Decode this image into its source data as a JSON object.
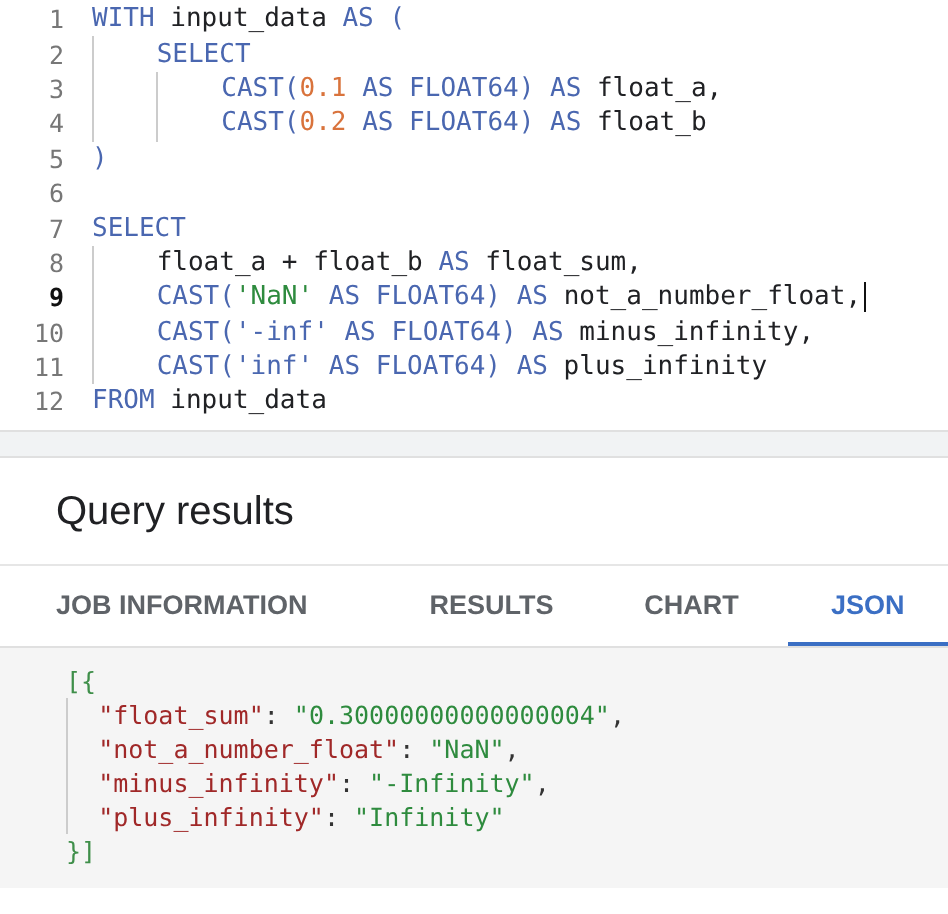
{
  "editor": {
    "lines": [
      {
        "number": "1",
        "active": false,
        "tokens": [
          {
            "kind": "kw",
            "text": "WITH"
          },
          {
            "kind": "id",
            "text": " input_data "
          },
          {
            "kind": "kw",
            "text": "AS ("
          }
        ]
      },
      {
        "number": "2",
        "active": false,
        "tokens": [
          {
            "kind": "kw",
            "text": "    SELECT"
          }
        ]
      },
      {
        "number": "3",
        "active": false,
        "tokens": [
          {
            "kind": "kw",
            "text": "        CAST("
          },
          {
            "kind": "num",
            "text": "0.1"
          },
          {
            "kind": "kw",
            "text": " AS FLOAT64) AS"
          },
          {
            "kind": "id",
            "text": " float_a,"
          }
        ]
      },
      {
        "number": "4",
        "active": false,
        "tokens": [
          {
            "kind": "kw",
            "text": "        CAST("
          },
          {
            "kind": "num",
            "text": "0.2"
          },
          {
            "kind": "kw",
            "text": " AS FLOAT64) AS"
          },
          {
            "kind": "id",
            "text": " float_b"
          }
        ]
      },
      {
        "number": "5",
        "active": false,
        "tokens": [
          {
            "kind": "kw",
            "text": ")"
          }
        ]
      },
      {
        "number": "6",
        "active": false
      },
      {
        "number": "7",
        "active": false,
        "tokens": [
          {
            "kind": "kw",
            "text": "SELECT"
          }
        ]
      },
      {
        "number": "8",
        "active": false,
        "tokens": [
          {
            "kind": "id",
            "text": "    float_a + float_b "
          },
          {
            "kind": "kw",
            "text": "AS"
          },
          {
            "kind": "id",
            "text": " float_sum,"
          }
        ]
      },
      {
        "number": "9",
        "active": true,
        "tokens": [
          {
            "kind": "kw",
            "text": "    CAST("
          },
          {
            "kind": "str",
            "text": "'NaN'"
          },
          {
            "kind": "kw",
            "text": " AS FLOAT64) AS"
          },
          {
            "kind": "id",
            "text": " not_a_number_float,"
          }
        ]
      },
      {
        "number": "10",
        "active": false,
        "tokens": [
          {
            "kind": "kw",
            "text": "    CAST('-inf' AS FLOAT64) AS"
          },
          {
            "kind": "id",
            "text": " minus_infinity,"
          }
        ]
      },
      {
        "number": "11",
        "active": false,
        "tokens": [
          {
            "kind": "kw",
            "text": "    CAST('inf' AS FLOAT64) AS"
          },
          {
            "kind": "id",
            "text": " plus_infinity"
          }
        ]
      },
      {
        "number": "12",
        "active": false,
        "tokens": [
          {
            "kind": "kw",
            "text": "FROM"
          },
          {
            "kind": "id",
            "text": " input_data"
          }
        ]
      }
    ]
  },
  "results": {
    "title": "Query results",
    "tabs": [
      {
        "label": "JOB INFORMATION",
        "selected": false
      },
      {
        "label": "RESULTS",
        "selected": false
      },
      {
        "label": "CHART",
        "selected": false
      },
      {
        "label": "JSON",
        "selected": true
      }
    ],
    "output": [
      {
        "tokens": [
          {
            "kind": "bracket",
            "text": "[{"
          }
        ]
      },
      {
        "tokens": [
          {
            "kind": "key",
            "text": "  \"float_sum\""
          },
          {
            "kind": "punct",
            "text": ": "
          },
          {
            "kind": "str",
            "text": "\"0.30000000000000004\""
          },
          {
            "kind": "punct",
            "text": ","
          }
        ]
      },
      {
        "tokens": [
          {
            "kind": "key",
            "text": "  \"not_a_number_float\""
          },
          {
            "kind": "punct",
            "text": ": "
          },
          {
            "kind": "str",
            "text": "\"NaN\""
          },
          {
            "kind": "punct",
            "text": ","
          }
        ]
      },
      {
        "tokens": [
          {
            "kind": "key",
            "text": "  \"minus_infinity\""
          },
          {
            "kind": "punct",
            "text": ": "
          },
          {
            "kind": "str",
            "text": "\"-Infinity\""
          },
          {
            "kind": "punct",
            "text": ","
          }
        ]
      },
      {
        "tokens": [
          {
            "kind": "key",
            "text": "  \"plus_infinity\""
          },
          {
            "kind": "punct",
            "text": ": "
          },
          {
            "kind": "str",
            "text": "\"Infinity\""
          }
        ]
      },
      {
        "tokens": [
          {
            "kind": "bracket",
            "text": "}]"
          }
        ]
      }
    ]
  }
}
